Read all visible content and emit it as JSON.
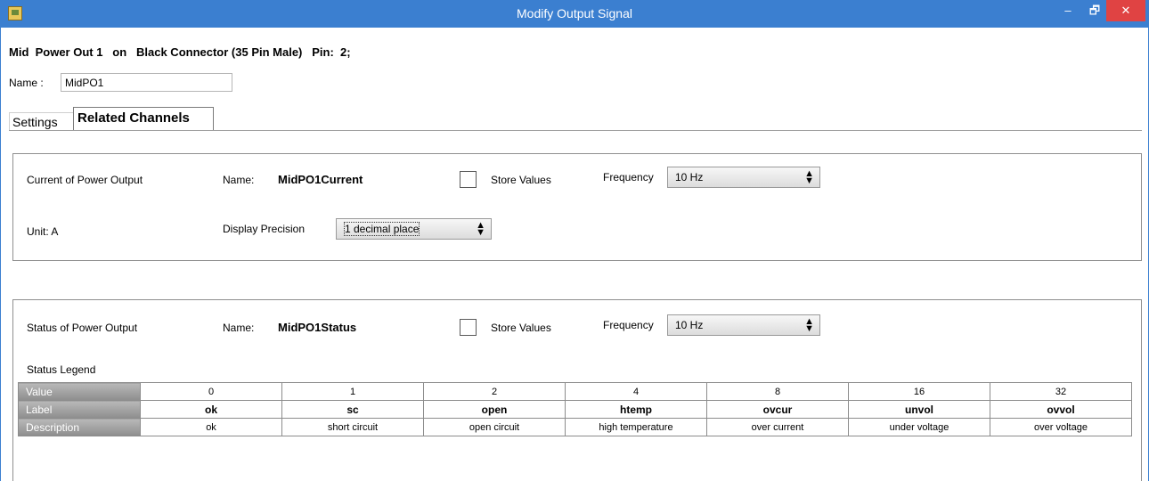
{
  "window": {
    "title": "Modify Output Signal",
    "min_glyph": "–",
    "max_glyph": "🗗",
    "close_glyph": "✕"
  },
  "heading": "Mid  Power Out 1   on   Black Connector (35 Pin Male)   Pin:  2;",
  "name_field": {
    "label": "Name :",
    "value": "MidPO1"
  },
  "tabs": {
    "settings": "Settings",
    "related": "Related Channels"
  },
  "current_channel": {
    "title": "Current of Power Output",
    "name_label": "Name:",
    "name_value": "MidPO1Current",
    "store_label": "Store Values",
    "store_checked": false,
    "frequency_label": "Frequency",
    "frequency_value": "10 Hz",
    "unit_text": "Unit:  A",
    "precision_label": "Display Precision",
    "precision_value": "1 decimal place"
  },
  "status_channel": {
    "title": "Status of Power Output",
    "name_label": "Name:",
    "name_value": "MidPO1Status",
    "store_label": "Store Values",
    "store_checked": false,
    "frequency_label": "Frequency",
    "frequency_value": "10 Hz",
    "legend_title": "Status Legend",
    "legend": {
      "row_headers": [
        "Value",
        "Label",
        "Description"
      ],
      "values": [
        "0",
        "1",
        "2",
        "4",
        "8",
        "16",
        "32"
      ],
      "labels": [
        "ok",
        "sc",
        "open",
        "htemp",
        "ovcur",
        "unvol",
        "ovvol"
      ],
      "descriptions": [
        "ok",
        "short circuit",
        "open circuit",
        "high temperature",
        "over current",
        "under voltage",
        "over voltage"
      ]
    }
  }
}
